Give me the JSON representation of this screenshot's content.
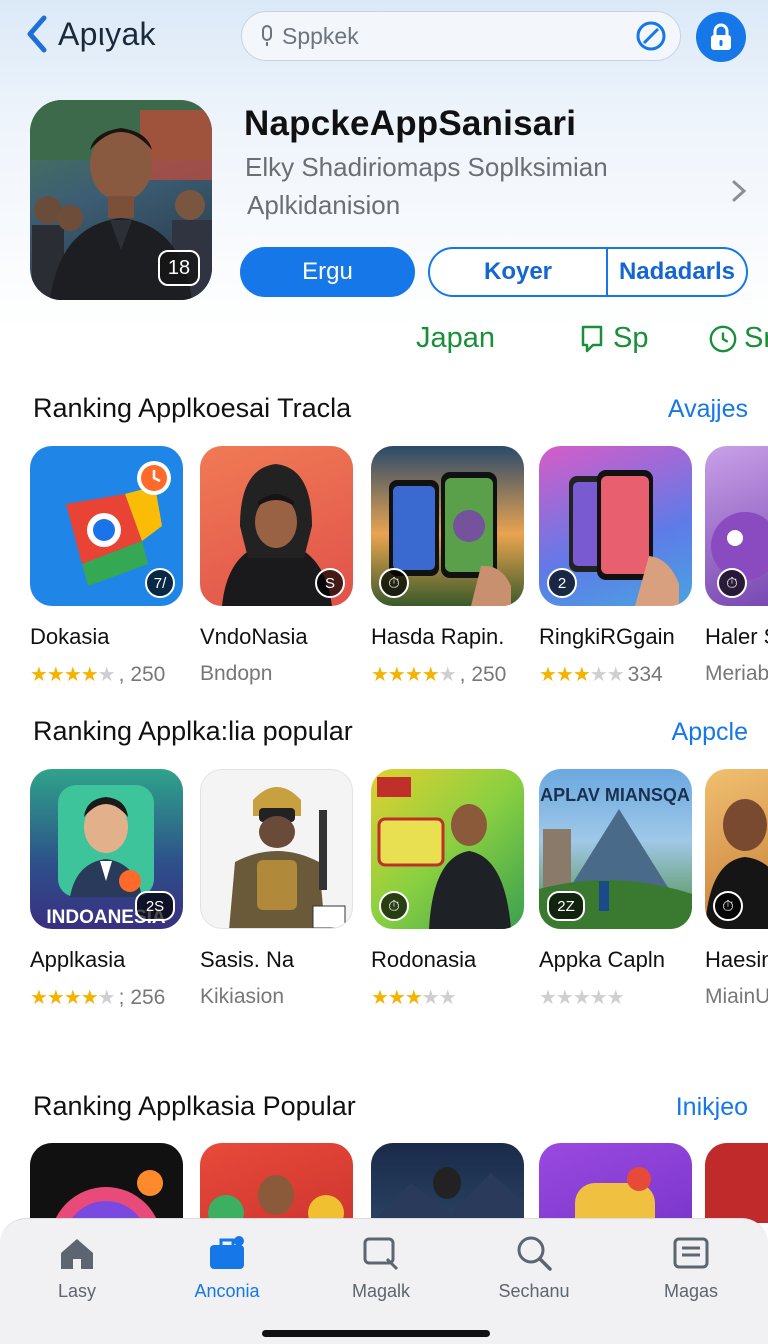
{
  "header": {
    "back_label": "Apιyak",
    "search_placeholder": "Sppkek"
  },
  "app": {
    "title": "NapckeAppSanisari",
    "subtitle_line1": "Elky Shadiriomaps  Soplksimian",
    "subtitle_line2": "Aplkidanision",
    "icon_badge": "18",
    "primary_button": "Ergu",
    "segment_left": "Koyer",
    "segment_right": "Nadadarls"
  },
  "chips": [
    {
      "label": "Japan",
      "icon": "none"
    },
    {
      "label": "Sp",
      "icon": "bell-icon"
    },
    {
      "label": "Sr",
      "icon": "clock-icon"
    }
  ],
  "sections": [
    {
      "title": "Ranking Applkoesai Tracla",
      "link": "Avajjes",
      "items": [
        {
          "name": "Dokasia",
          "stars": 4,
          "count": ", 250",
          "badge": "7/"
        },
        {
          "name": "VndoNasia",
          "stars": 0,
          "count": "Bndopn",
          "badge": "S"
        },
        {
          "name": "Hasda Rapin.",
          "stars": 4,
          "count": ", 250",
          "badge": "⏱"
        },
        {
          "name": "RingkiRGgain",
          "stars": 3,
          "count": "334",
          "badge": "2"
        },
        {
          "name": "Haler S",
          "stars": 0,
          "count": "Meriab",
          "badge": "⏱"
        }
      ]
    },
    {
      "title": "Ranking Applka:lia popular",
      "link": "Appcle",
      "items": [
        {
          "name": "Applkasia",
          "stars": 4,
          "count": "; 256",
          "badge": "2S",
          "icon_text": "INDOANESIA"
        },
        {
          "name": "Sasis. Na",
          "stars": 0,
          "count": "Kikiasion",
          "badge": ""
        },
        {
          "name": "Rodonasia",
          "stars": 3,
          "count": "",
          "badge": "⏱"
        },
        {
          "name": "Appka Capln",
          "stars": 0,
          "count": "",
          "badge": "2Z",
          "icon_text": "APLAV MIANSQA"
        },
        {
          "name": "Haesin",
          "stars": 0,
          "count": "MiainU",
          "badge": "⏱"
        }
      ]
    },
    {
      "title": "Ranking Applkasia Popular",
      "link": "Inikjeo"
    }
  ],
  "tabs": [
    {
      "label": "Lasy",
      "icon": "home-icon"
    },
    {
      "label": "Anconia",
      "icon": "briefcase-icon",
      "active": true
    },
    {
      "label": "Magalk",
      "icon": "chat-search-icon"
    },
    {
      "label": "Sechanu",
      "icon": "search-icon"
    },
    {
      "label": "Magas",
      "icon": "list-icon"
    }
  ],
  "colors": {
    "accent": "#1677e8",
    "chip_green": "#1a8f3a",
    "star": "#f5b301"
  }
}
